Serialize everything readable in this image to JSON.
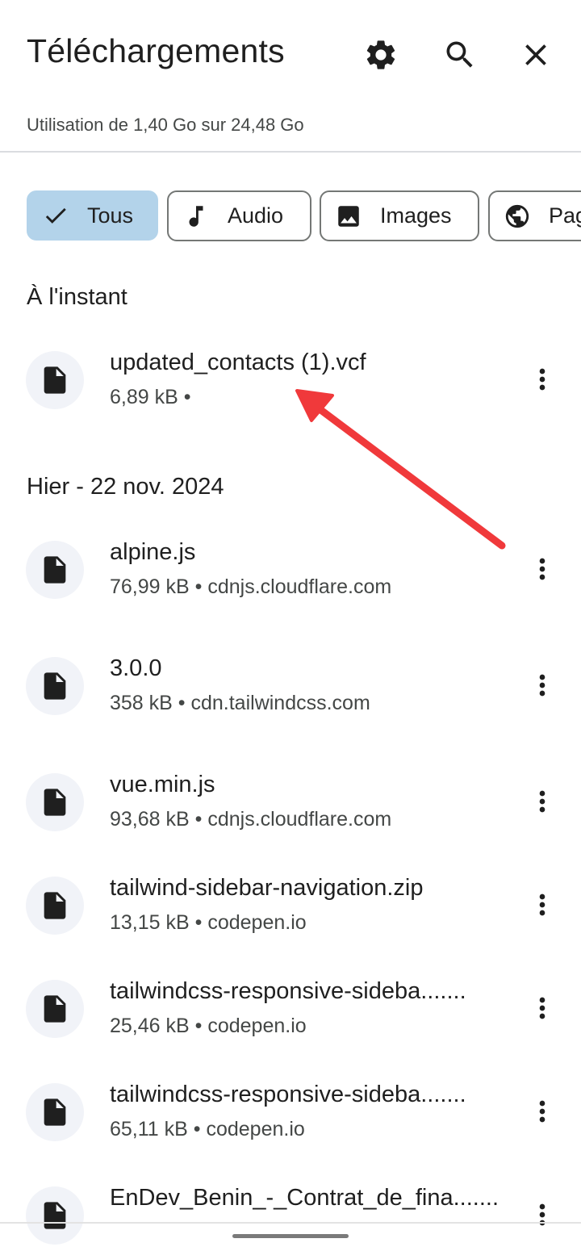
{
  "header": {
    "title": "Téléchargements",
    "usage": "Utilisation de 1,40 Go sur 24,48 Go"
  },
  "filters": [
    {
      "label": "Tous",
      "selected": true,
      "icon": "check-icon"
    },
    {
      "label": "Audio",
      "selected": false,
      "icon": "music-note-icon"
    },
    {
      "label": "Images",
      "selected": false,
      "icon": "image-icon"
    },
    {
      "label": "Pag",
      "selected": false,
      "icon": "globe-icon"
    }
  ],
  "sections": [
    {
      "title": "À l'instant",
      "items": [
        {
          "name": "updated_contacts (1).vcf",
          "meta": "6,89 kB •"
        }
      ]
    },
    {
      "title": "Hier - 22 nov. 2024",
      "items": [
        {
          "name": "alpine.js",
          "meta": "76,99 kB • cdnjs.cloudflare.com"
        },
        {
          "name": "3.0.0",
          "meta": "358 kB • cdn.tailwindcss.com"
        },
        {
          "name": "vue.min.js",
          "meta": "93,68 kB • cdnjs.cloudflare.com"
        },
        {
          "name": "tailwind-sidebar-navigation.zip",
          "meta": "13,15 kB • codepen.io"
        },
        {
          "name": "tailwindcss-responsive-sideba.......",
          "meta": "25,46 kB • codepen.io"
        },
        {
          "name": "tailwindcss-responsive-sideba.......",
          "meta": "65,11 kB • codepen.io"
        },
        {
          "name": "EnDev_Benin_-_Contrat_de_fina.......",
          "meta": ""
        }
      ]
    }
  ],
  "colors": {
    "accent_chip": "#b3d3ea",
    "annotation_arrow": "#f0393b"
  }
}
